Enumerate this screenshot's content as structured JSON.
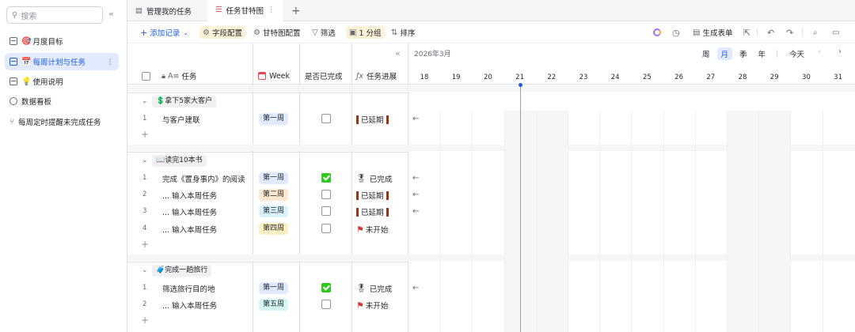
{
  "sidebar": {
    "search_placeholder": "搜索",
    "collapse": "«",
    "items": [
      {
        "emoji": "🎯",
        "label": "月度目标"
      },
      {
        "emoji": "📅",
        "label": "每周计划与任务"
      },
      {
        "emoji": "💡",
        "label": "使用说明"
      },
      {
        "emoji": "",
        "label": "数据看板"
      },
      {
        "emoji": "",
        "label": "每周定时提醒未完成任务"
      }
    ],
    "more": "⋮"
  },
  "tabs": [
    {
      "label": "管理我的任务"
    },
    {
      "label": "任务甘特图"
    }
  ],
  "tab_more": "⋮",
  "tab_add": "+",
  "toolbar": {
    "add_record": "添加记录",
    "field_config": "字段配置",
    "gantt_config": "甘特图配置",
    "filter": "筛选",
    "group": "1 分组",
    "sort": "排序",
    "gen_form": "生成表单"
  },
  "columns": {
    "task": "任务",
    "week": "Week",
    "done": "是否已完成",
    "progress": "任务进展"
  },
  "groups": [
    {
      "emoji": "💲",
      "label": "拿下5家大客户",
      "rows": [
        {
          "num": "1",
          "task": "与客户建联",
          "week": "第一周",
          "done": false,
          "progress": "已延期",
          "status": "delayed"
        }
      ]
    },
    {
      "emoji": "📖",
      "label": "读完10本书",
      "rows": [
        {
          "num": "1",
          "task": "完成《置身事内》的阅读",
          "week": "第一周",
          "done": true,
          "progress": "已完成",
          "status": "done"
        },
        {
          "num": "2",
          "task": "... 输入本周任务",
          "week": "第二周",
          "done": false,
          "progress": "已延期",
          "status": "delayed"
        },
        {
          "num": "3",
          "task": "... 输入本周任务",
          "week": "第三周",
          "done": false,
          "progress": "已延期",
          "status": "delayed"
        },
        {
          "num": "4",
          "task": "... 输入本周任务",
          "week": "第四周",
          "done": false,
          "progress": "未开始",
          "status": "todo"
        }
      ]
    },
    {
      "emoji": "🧳",
      "label": "完成一趟旅行",
      "rows": [
        {
          "num": "1",
          "task": "筛选旅行目的地",
          "week": "第一周",
          "done": true,
          "progress": "已完成",
          "status": "done"
        },
        {
          "num": "2",
          "task": "... 输入本周任务",
          "week": "第五周",
          "done": false,
          "progress": "未开始",
          "status": "todo"
        }
      ]
    }
  ],
  "week_colors": {
    "第一周": "#e1eaff",
    "第二周": "#fde8cf",
    "第三周": "#d9f3fd",
    "第四周": "#fdf1c4",
    "第五周": "#d5f6f2"
  },
  "gantt": {
    "month": "2026年3月",
    "scales": [
      "周",
      "月",
      "季",
      "年"
    ],
    "active_scale": "月",
    "today": "今天",
    "days": [
      "18",
      "19",
      "20",
      "21",
      "22",
      "23",
      "24",
      "25",
      "26",
      "27",
      "28",
      "29",
      "30",
      "31"
    ],
    "weekend_days": [
      "21",
      "22",
      "28",
      "29"
    ],
    "today_day": "21"
  },
  "colors": {
    "accent": "#245bdb",
    "today_line": "#7aa2f7"
  }
}
